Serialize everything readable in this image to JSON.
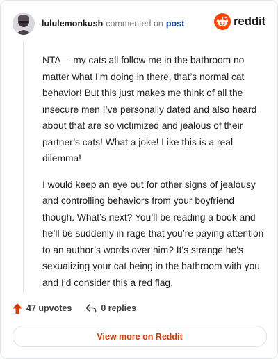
{
  "header": {
    "username": "lululemonkush",
    "action_text": "commented on",
    "post_link": "post",
    "brand": "reddit"
  },
  "comment": {
    "paragraphs": [
      "NTA— my cats all follow me in the bathroom no matter what I’m doing in there, that’s normal cat behavior! But this just makes me think of all the insecure men I’ve personally dated and also heard about that are so victimized and jealous of their partner’s cats! What a joke! Like this is a real dilemma!",
      "I would keep an eye out for other signs of jealousy and controlling behaviors from your boyfriend though. What’s next? You’ll be reading a book and he’ll be suddenly in rage that you’re paying attention to an author’s words over him? It’s strange he’s sexualizing your cat being in the bathroom with you and I’d consider this a red flag."
    ]
  },
  "actions": {
    "upvotes": "47 upvotes",
    "replies": "0 replies"
  },
  "footer": {
    "view_more": "View more on Reddit"
  },
  "colors": {
    "accent": "#ff4500",
    "upvote": "#d93a00",
    "link": "#0a449b"
  },
  "icons": {
    "brand": "reddit-snoo-icon",
    "upvote": "upvote-arrow-icon",
    "reply": "reply-arrow-icon"
  }
}
